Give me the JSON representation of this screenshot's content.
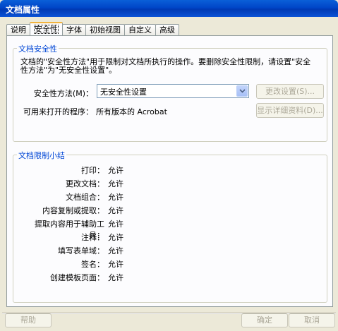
{
  "window": {
    "title": "文档属性"
  },
  "tabs": [
    {
      "label": "说明"
    },
    {
      "label": "安全性",
      "active": true
    },
    {
      "label": "字体"
    },
    {
      "label": "初始视图"
    },
    {
      "label": "自定义"
    },
    {
      "label": "高级"
    }
  ],
  "security": {
    "group_title": "文档安全性",
    "description": "文档的\"安全性方法\"用于限制对文档所执行的操作。要删除安全性限制，请设置\"安全性方法\"为\"无安全性设置\"。",
    "method_label": "安全性方法(M)：",
    "method_value": "无安全性设置",
    "change_button": "更改设置(S)...",
    "open_label": "可用来打开的程序：",
    "open_value": "所有版本的 Acrobat",
    "details_button": "显示详细资料(D)..."
  },
  "summary": {
    "group_title": "文档限制小结",
    "rows": [
      {
        "label": "打印：",
        "value": "允许"
      },
      {
        "label": "更改文档：",
        "value": "允许"
      },
      {
        "label": "文档组合：",
        "value": "允许"
      },
      {
        "label": "内容复制或提取：",
        "value": "允许"
      },
      {
        "label": "提取内容用于辅助工具：",
        "value": "允许"
      },
      {
        "label": "注释：",
        "value": "允许"
      },
      {
        "label": "填写表单域：",
        "value": "允许"
      },
      {
        "label": "签名：",
        "value": "允许"
      },
      {
        "label": "创建模板页面：",
        "value": "允许"
      }
    ]
  },
  "footer": {
    "help": "帮助",
    "ok": "确定",
    "cancel": "取消"
  }
}
